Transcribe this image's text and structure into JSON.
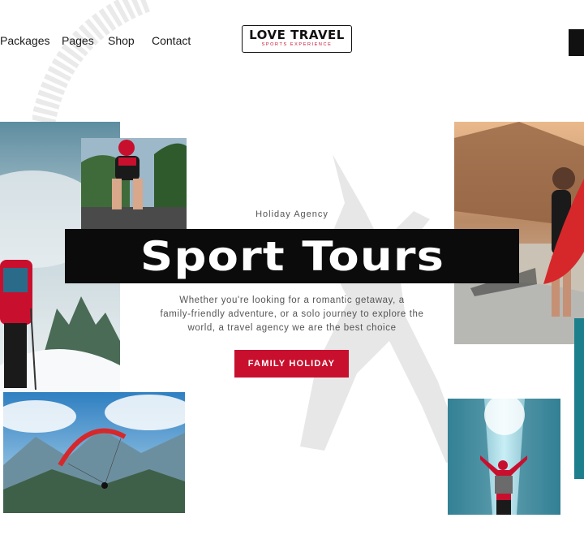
{
  "nav": {
    "items": [
      "Packages",
      "Pages",
      "Shop",
      "Contact"
    ]
  },
  "logo": {
    "main": "LOVE TRAVEL",
    "sub": "SPORTS EXPERIENCE"
  },
  "hero": {
    "eyebrow": "Holiday Agency",
    "title": "Sport Tours",
    "description": [
      "Whether you're looking for a romantic getaway, a",
      "family-friendly adventure, or a solo journey to explore the",
      "world, a travel agency we are  the best choice"
    ],
    "cta_label": "FAMILY HOLIDAY"
  },
  "colors": {
    "accent": "#c8102e",
    "dark": "#0b0b0b",
    "text_muted": "#555555"
  },
  "photos": [
    "snowy-mountain-hiker",
    "road-cyclist",
    "paraglider-over-mountains",
    "surfer-girl-on-beach",
    "ice-cave-explorer"
  ]
}
